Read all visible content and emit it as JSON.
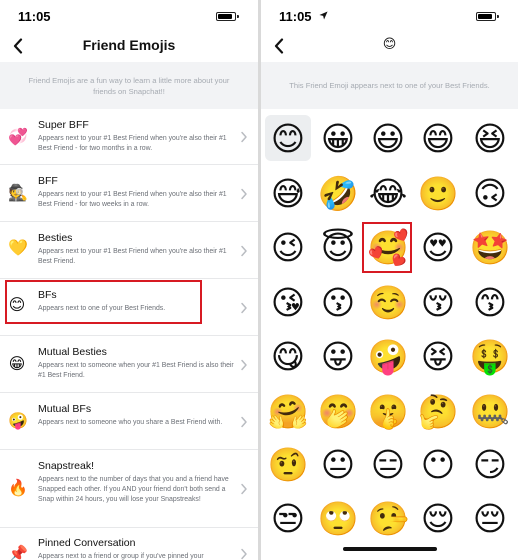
{
  "left": {
    "status_time": "11:05",
    "title": "Friend Emojis",
    "intro": "Friend Emojis are a fun way to learn a little more about your friends on Snapchat!!",
    "items": [
      {
        "emoji": "💞",
        "icon": "heart-love-icon",
        "title": "Super BFF",
        "desc": "Appears next to your #1 Best Friend when you're also their #1 Best Friend - for two months in a row."
      },
      {
        "emoji": "🕵️",
        "icon": "detective-icon",
        "title": "BFF",
        "desc": "Appears next to your #1 Best Friend when you're also their #1 Best Friend - for two weeks in a row."
      },
      {
        "emoji": "💛",
        "icon": "yellow-heart-icon",
        "title": "Besties",
        "desc": "Appears next to your #1 Best Friend when you're also their #1 Best Friend."
      },
      {
        "emoji": "😊",
        "icon": "smiling-face-icon",
        "title": "BFs",
        "desc": "Appears next to one of your Best Friends."
      },
      {
        "emoji": "😁",
        "icon": "grimacing-face-icon",
        "title": "Mutual Besties",
        "desc": "Appears next to someone when your #1 Best Friend is also their #1 Best Friend."
      },
      {
        "emoji": "🤪",
        "icon": "zany-face-icon",
        "title": "Mutual BFs",
        "desc": "Appears next to someone who you share a Best Friend with."
      },
      {
        "emoji": "🔥",
        "icon": "fire-icon",
        "title": "Snapstreak!",
        "desc": "Appears next to the number of days that you and a friend have Snapped each other. If you AND your friend don't both send a Snap within 24 hours, you will lose your Snapstreaks!"
      },
      {
        "emoji": "📌",
        "icon": "pushpin-icon",
        "title": "Pinned Conversation",
        "desc": "Appears next to a friend or group if you've pinned your conversation with them to the top of your feed."
      }
    ]
  },
  "right": {
    "status_time": "11:05",
    "title_emoji": "😊",
    "intro": "This Friend Emoji appears next to one of your Best Friends.",
    "emojis": [
      "😊",
      "😀",
      "😃",
      "😄",
      "😆",
      "😅",
      "🤣",
      "😂",
      "🙂",
      "🙃",
      "😉",
      "😇",
      "🥰",
      "😍",
      "🤩",
      "😘",
      "😗",
      "☺️",
      "😚",
      "😙",
      "😋",
      "😛",
      "🤪",
      "😝",
      "🤑",
      "🤗",
      "🤭",
      "🤫",
      "🤔",
      "🤐",
      "🤨",
      "😐",
      "😑",
      "😶",
      "😏",
      "😒",
      "🙄",
      "🤥",
      "😌",
      "😔"
    ]
  }
}
